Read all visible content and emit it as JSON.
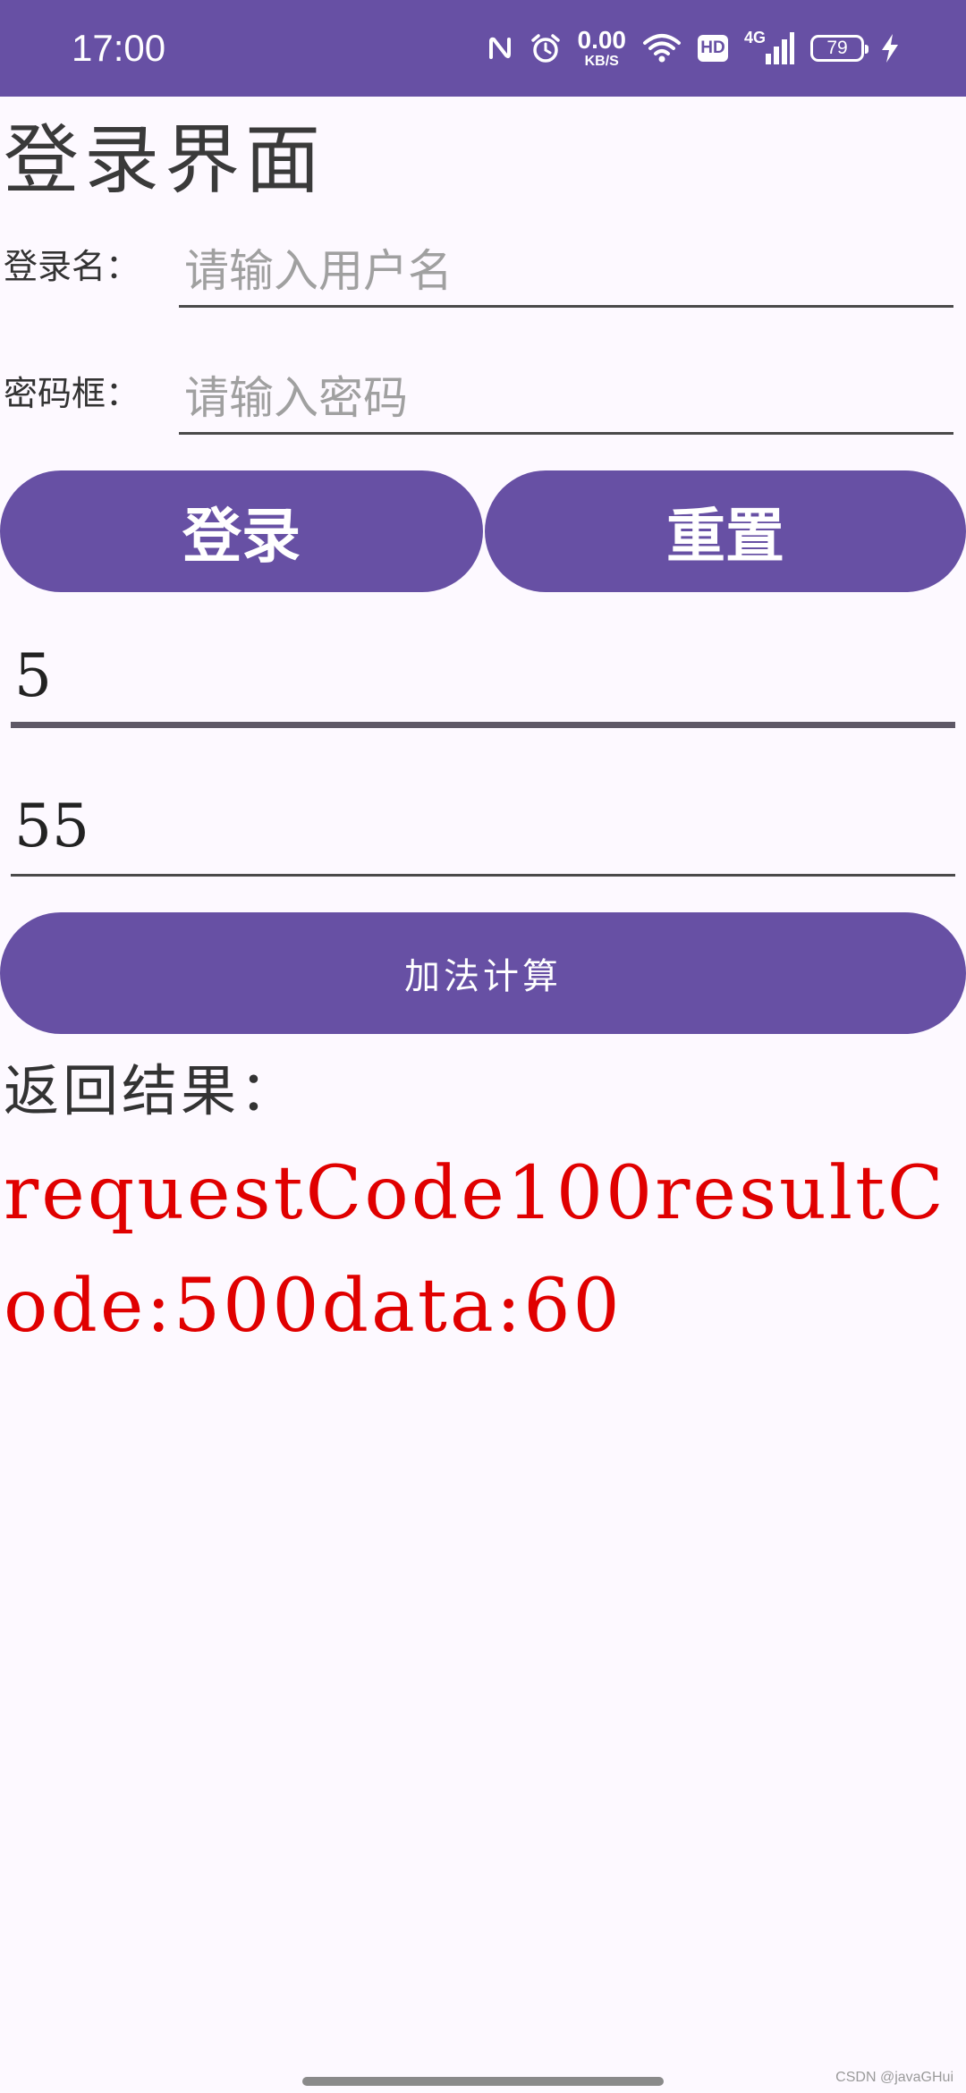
{
  "status_bar": {
    "time": "17:00",
    "net_speed_value": "0.00",
    "net_speed_unit": "KB/S",
    "hd_label": "HD",
    "network_type": "4G",
    "battery_level": "79",
    "icons": [
      "nfc-icon",
      "alarm-icon",
      "wifi-icon",
      "hd-icon",
      "signal-icon",
      "battery-icon",
      "charging-icon"
    ],
    "background_color": "#6750a4"
  },
  "login": {
    "title": "登录界面",
    "username_label": "登录名：",
    "username_placeholder": "请输入用户名",
    "password_label": "密码框：",
    "password_placeholder": "请输入密码",
    "login_button": "登录",
    "reset_button": "重置"
  },
  "calculator": {
    "first_value": "5",
    "second_value": "55",
    "add_button": "加法计算",
    "result_label": "返回结果：",
    "result_text": "requestCode100resultCode:500data:60",
    "result_color": "#e00000"
  },
  "watermark": "CSDN @javaGHui",
  "colors": {
    "accent": "#6750a4",
    "background": "#fdf9ff"
  }
}
